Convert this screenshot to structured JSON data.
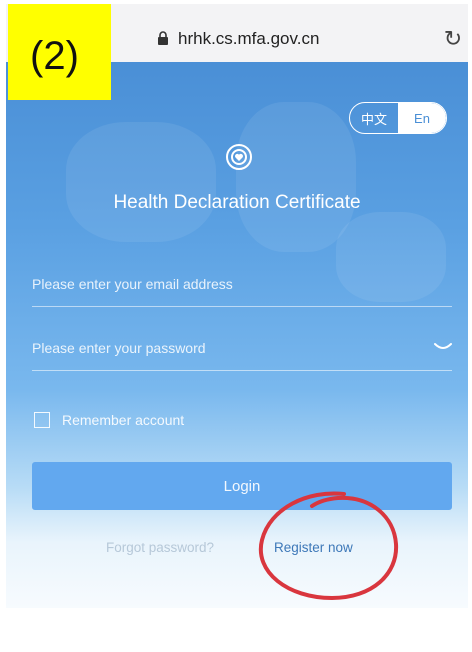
{
  "browser": {
    "url": "hrhk.cs.mfa.gov.cn"
  },
  "overlay": {
    "step_label": "(2)"
  },
  "app": {
    "language": {
      "zh": "中文",
      "en": "En",
      "selected": "En"
    },
    "title": "Health Declaration Certificate",
    "email_placeholder": "Please enter your email address",
    "password_placeholder": "Please enter your password",
    "remember_label": "Remember account",
    "login_label": "Login",
    "forgot_label": "Forgot password?",
    "register_label": "Register now"
  },
  "colors": {
    "panel_top": "#4a8fd6",
    "button": "#62a8ef",
    "register_link": "#3d78b8",
    "annotation_circle": "#d9363e",
    "step_highlight": "#ffff00"
  }
}
